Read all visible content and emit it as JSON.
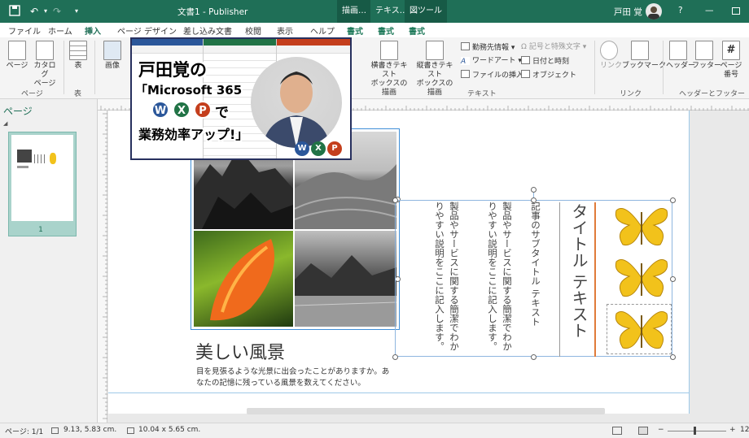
{
  "titlebar": {
    "doc_title": "文書1 - Publisher",
    "ctx_tab1": "描画…",
    "ctx_tab2": "テキス…",
    "ctx_tab3": "図ツール",
    "user": "戸田 覚",
    "help": "?",
    "accent": "#1f6f57"
  },
  "tabs": [
    "ファイル",
    "ホーム",
    "挿入",
    "ページ デザイン",
    "差し込み文書",
    "校閲",
    "表示",
    "ヘルプ",
    "書式",
    "書式",
    "書式"
  ],
  "ribbon": {
    "page": "ページ",
    "catalog_page": "カタログ\nページ",
    "group_pages": "ページ",
    "table": "表",
    "group_table": "表",
    "image": "画像",
    "horiz_textbox": "横書きテキスト\nボックスの描画",
    "vert_textbox": "縦書きテキスト\nボックスの描画",
    "business_info": "勤務先情報",
    "wordart": "ワードアート",
    "insert_file": "ファイルの挿入",
    "symbols": "記号と特殊文字",
    "datetime": "日付と時刻",
    "object": "オブジェクト",
    "group_text": "テキスト",
    "link": "リンク",
    "bookmark": "ブックマーク",
    "group_link": "リンク",
    "header": "ヘッダー",
    "footer": "フッター",
    "page_number": "ページ\n番号",
    "group_hf": "ヘッダーとフッター"
  },
  "ad": {
    "line1": "戸田覚の",
    "line2": "「Microsoft 365",
    "line3": "で",
    "line4": "業務効率アップ!」",
    "badges": [
      "W",
      "X",
      "P"
    ]
  },
  "pagepane": {
    "title": "ページ",
    "thumb_num": "1"
  },
  "document": {
    "heading": "美しい風景",
    "body": "目を見張るような光景に出会ったことがありますか。あなたの記憶に残っている風景を数えてください。",
    "v_title": "タイトル テキスト",
    "v_subtitle": "記事のサブタイトル テキスト",
    "v_col1": "製品やサービスに関する簡潔でわかりやすい説明をここに記入します。",
    "v_col2": "製品やサービスに関する簡潔でわかりやすい説明をここに記入します。"
  },
  "status": {
    "page": "ページ: 1/1",
    "position": "9.13, 5.83 cm.",
    "size": "10.04 x 5.65 cm.",
    "zoom": "12"
  }
}
